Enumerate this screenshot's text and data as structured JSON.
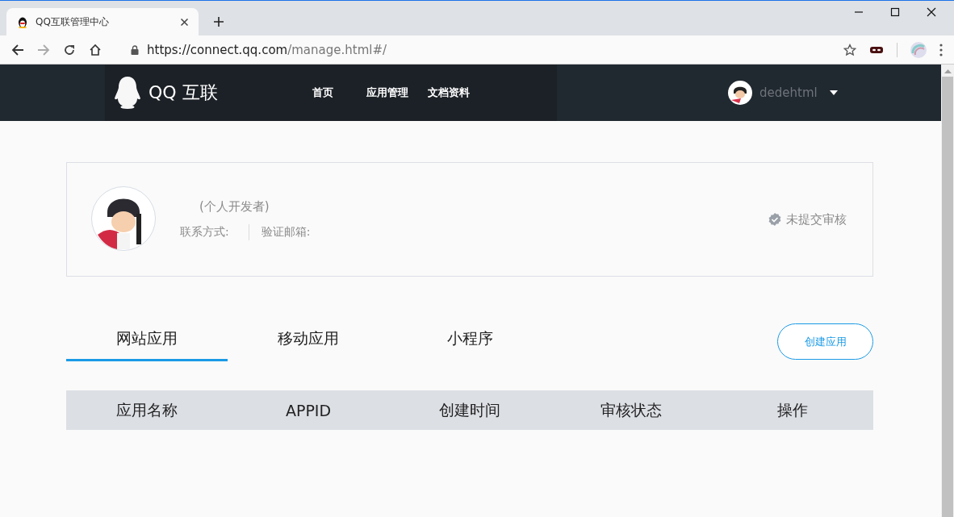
{
  "browser": {
    "tab_title": "QQ互联管理中心",
    "url_host": "https://connect.qq.com",
    "url_path": "/manage.html#/"
  },
  "header": {
    "logo_text": "QQ 互联",
    "nav": [
      {
        "label": "首页"
      },
      {
        "label": "应用管理"
      },
      {
        "label": "文档资料"
      }
    ],
    "user_name": "dedehtml"
  },
  "profile": {
    "developer_type": "(个人开发者)",
    "contact_label": "联系方式:",
    "email_label": "验证邮箱:",
    "review_status": "未提交审核"
  },
  "tabs": [
    {
      "label": "网站应用",
      "selected": true
    },
    {
      "label": "移动应用",
      "selected": false
    },
    {
      "label": "小程序",
      "selected": false
    }
  ],
  "create_button": "创建应用",
  "table": {
    "columns": [
      "应用名称",
      "APPID",
      "创建时间",
      "审核状态",
      "操作"
    ]
  }
}
